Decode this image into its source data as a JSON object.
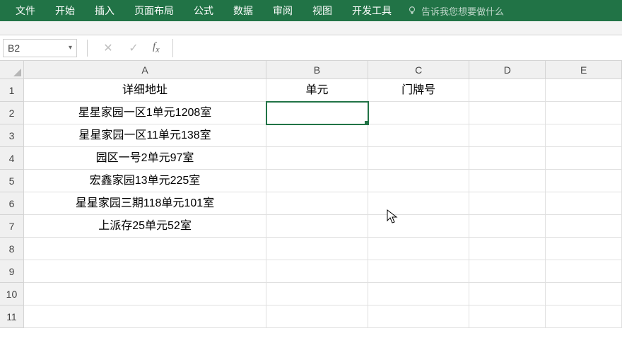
{
  "ribbon": {
    "tabs": [
      "文件",
      "开始",
      "插入",
      "页面布局",
      "公式",
      "数据",
      "审阅",
      "视图",
      "开发工具"
    ],
    "tell_me": "告诉我您想要做什么"
  },
  "formula_bar": {
    "name_box": "B2",
    "formula": ""
  },
  "columns": [
    "A",
    "B",
    "C",
    "D",
    "E"
  ],
  "rows": [
    "1",
    "2",
    "3",
    "4",
    "5",
    "6",
    "7",
    "8",
    "9",
    "10",
    "11"
  ],
  "cells": {
    "A1": "详细地址",
    "B1": "单元",
    "C1": "门牌号",
    "A2": "星星家园一区1单元1208室",
    "A3": "星星家园一区11单元138室",
    "A4": "园区一号2单元97室",
    "A5": "宏鑫家园13单元225室",
    "A6": "星星家园三期118单元101室",
    "A7": "上派存25单元52室"
  },
  "selected_cell": "B2"
}
